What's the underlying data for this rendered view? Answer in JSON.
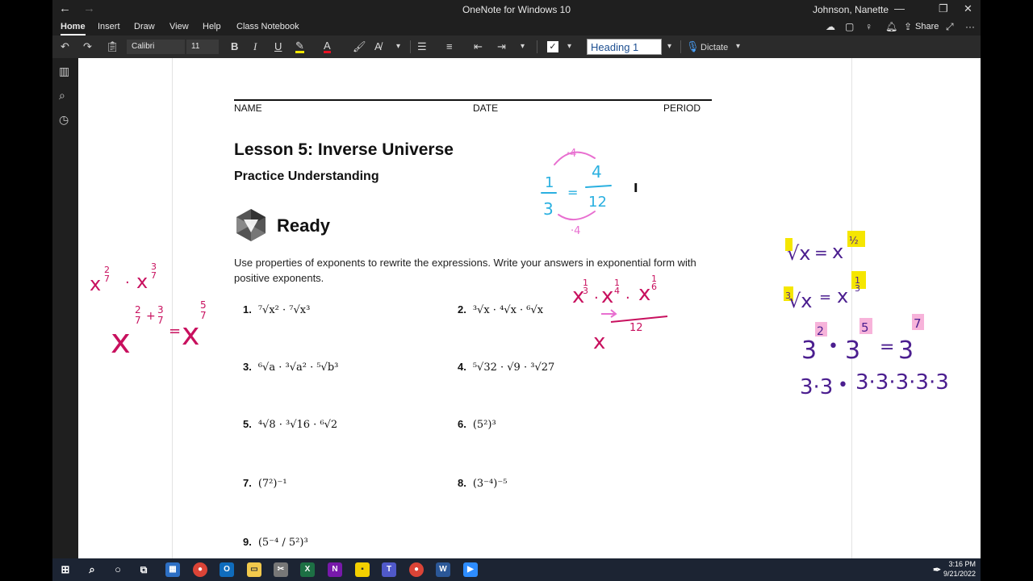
{
  "window": {
    "title": "OneNote for Windows 10",
    "user": "Johnson, Nanette"
  },
  "menu": {
    "tabs": [
      "Home",
      "Insert",
      "Draw",
      "View",
      "Help",
      "Class Notebook"
    ],
    "share_label": "Share"
  },
  "ribbon": {
    "font_name": "Calibri",
    "font_size": "11",
    "style": "Heading 1",
    "dictate_label": "Dictate"
  },
  "document": {
    "header_labels": [
      "NAME",
      "DATE",
      "PERIOD"
    ],
    "lesson_title": "Lesson 5: Inverse Universe",
    "subtitle": "Practice Understanding",
    "section_label": "Ready",
    "instructions": "Use properties of exponents to rewrite the expressions. Write your answers in exponential form with positive exponents.",
    "problems": [
      {
        "number": "1.",
        "expr": "⁷√x² · ⁷√x³"
      },
      {
        "number": "2.",
        "expr": "³√x · ⁴√x · ⁶√x"
      },
      {
        "number": "3.",
        "expr": "⁶√a · ³√a² · ⁵√b³"
      },
      {
        "number": "4.",
        "expr": "⁵√32 · √9 · ³√27"
      },
      {
        "number": "5.",
        "expr": "⁴√8 · ³√16 · ⁶√2"
      },
      {
        "number": "6.",
        "expr": "(5²)³"
      },
      {
        "number": "7.",
        "expr": "(7²)⁻¹"
      },
      {
        "number": "8.",
        "expr": "(3⁻⁴)⁻⁵"
      },
      {
        "number": "9.",
        "expr": "(5⁻⁴ / 5²)³"
      }
    ]
  },
  "ink": {
    "colors": {
      "magenta": "#c8105e",
      "purple": "#4b1e8f",
      "pink": "#e86fd0",
      "cyan": "#2ab0e0",
      "yellow": "#f5e600"
    }
  },
  "taskbar": {
    "time": "3:16 PM",
    "date": "9/21/2022"
  }
}
